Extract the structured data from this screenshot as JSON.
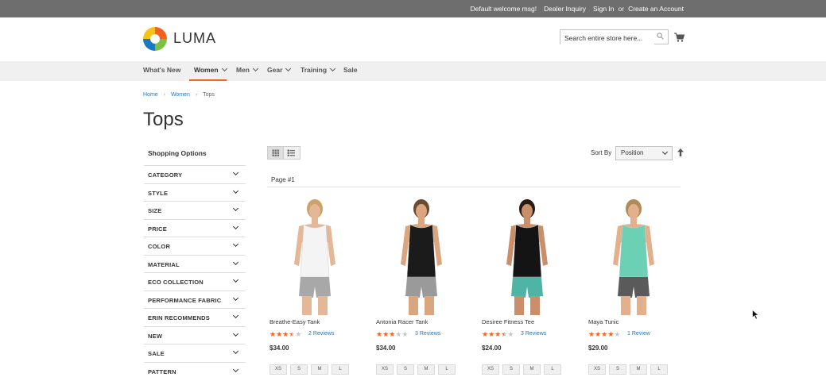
{
  "topbar": {
    "welcome": "Default welcome msg!",
    "dealer": "Dealer Inquiry",
    "signin": "Sign In",
    "or": "or",
    "create": "Create an Account"
  },
  "header": {
    "logo_text": "LUMA",
    "search_placeholder": "Search entire store here...",
    "brand_colors": [
      "#f26322",
      "#7cc242",
      "#1979c3",
      "#f8c21a"
    ]
  },
  "nav": {
    "items": [
      "What's New",
      "Women",
      "Men",
      "Gear",
      "Training",
      "Sale"
    ],
    "active": "Women",
    "accent_color": "#f26322"
  },
  "breadcrumb": {
    "home": "Home",
    "women": "Women",
    "current": "Tops",
    "link_color": "#1979c3"
  },
  "page_title": "Tops",
  "sidebar": {
    "heading": "Shopping Options",
    "filters": [
      "CATEGORY",
      "STYLE",
      "SIZE",
      "PRICE",
      "COLOR",
      "MATERIAL",
      "ECO COLLECTION",
      "PERFORMANCE FABRIC",
      "ERIN RECOMMENDS",
      "NEW",
      "SALE",
      "PATTERN"
    ]
  },
  "toolbar": {
    "sort_label": "Sort By",
    "sort_value": "Position",
    "page": "Page #1"
  },
  "products": [
    {
      "name": "Breathe-Easy Tank",
      "rating_stars": 3.5,
      "reviews": "2 Reviews",
      "price": "$34.00",
      "top_color": "#f4f4f4",
      "bottom_color": "#a8a8a8",
      "skin": "#e4b796",
      "hair": "#c9a36a"
    },
    {
      "name": "Antonia Racer Tank",
      "rating_stars": 3,
      "reviews": "3 Reviews",
      "price": "$34.00",
      "top_color": "#1b1b1b",
      "bottom_color": "#9a9a9a",
      "skin": "#d9a67f",
      "hair": "#6a4a30"
    },
    {
      "name": "Desiree Fitness Tee",
      "rating_stars": 3.5,
      "reviews": "3 Reviews",
      "price": "$24.00",
      "top_color": "#141414",
      "bottom_color": "#4fb3a6",
      "skin": "#c98e6a",
      "hair": "#2b1a12"
    },
    {
      "name": "Maya Tunic",
      "rating_stars": 4,
      "reviews": "1 Review",
      "price": "$29.00",
      "top_color": "#6cd1b4",
      "bottom_color": "#5a5a5a",
      "skin": "#e2b08c",
      "hair": "#b08a58"
    }
  ],
  "sizes": [
    "XS",
    "S",
    "M",
    "L"
  ]
}
